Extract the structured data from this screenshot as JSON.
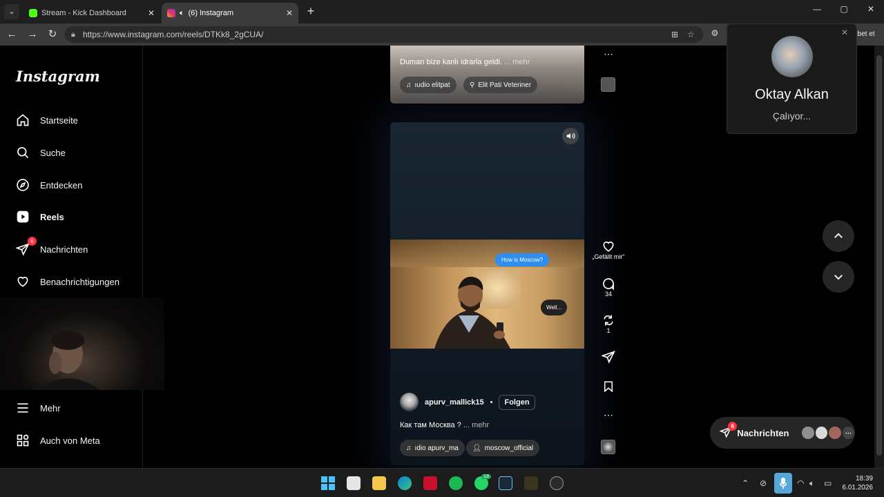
{
  "browser": {
    "tabs": [
      {
        "title": "Stream - Kick Dashboard",
        "color": "#53fc18"
      },
      {
        "title": "(6) Instagram",
        "color": "#e1306c"
      }
    ],
    "url": "https://www.instagram.com/reels/DTKk8_2gCUA/",
    "signin_label": "abet et"
  },
  "sidebar": {
    "logo": "Instagram",
    "items": [
      {
        "label": "Startseite",
        "icon": "home-icon"
      },
      {
        "label": "Suche",
        "icon": "search-icon"
      },
      {
        "label": "Entdecken",
        "icon": "compass-icon"
      },
      {
        "label": "Reels",
        "icon": "reels-icon"
      },
      {
        "label": "Nachrichten",
        "icon": "messenger-icon",
        "badge": "6"
      },
      {
        "label": "Benachrichtigungen",
        "icon": "heart-icon"
      },
      {
        "label": "Mehr",
        "icon": "menu-icon"
      },
      {
        "label": "Auch von Meta",
        "icon": "meta-icon"
      }
    ]
  },
  "reel_prev": {
    "caption": "Duman bize kanlı idrarla geldi.",
    "more": "... mehr",
    "audio": "ıudio   elitpat",
    "location": "Elit Pati Veteriner"
  },
  "reel": {
    "bubble_1": "How is Moscow?",
    "bubble_2": "Well...",
    "author": "apurv_mallick15",
    "dot": "•",
    "follow": "Folgen",
    "caption": "Как там Москва ?",
    "more": "... mehr",
    "audio": "ıdio   apurv_ma",
    "tagged": "moscow_official",
    "likes_label": "„Gefällt mir\"",
    "comments": "34",
    "reposts": "1"
  },
  "call": {
    "name": "Oktay Alkan",
    "status": "Çalıyor..."
  },
  "messages_pill": {
    "label": "Nachrichten",
    "badge": "6"
  },
  "taskbar": {
    "whatsapp_badge": "13",
    "time": "18:39",
    "date": "6.01.2026"
  }
}
